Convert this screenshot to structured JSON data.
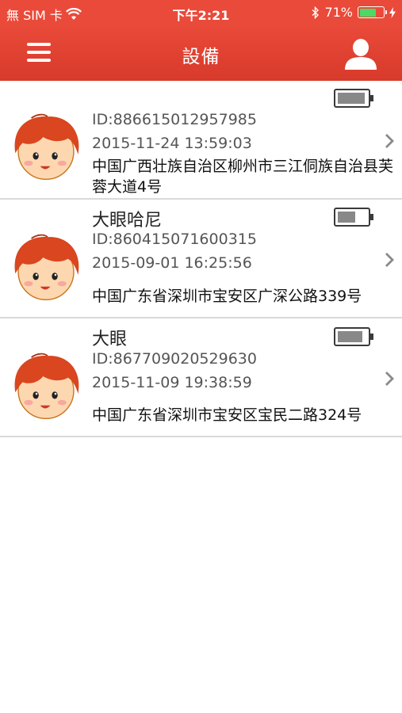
{
  "status_bar": {
    "carrier": "無 SIM 卡",
    "time": "下午2:21",
    "battery_percent": "71%",
    "battery_level": 0.71,
    "icons": [
      "wifi-icon",
      "bluetooth-icon",
      "battery-icon",
      "charging-bolt-icon"
    ]
  },
  "nav": {
    "title": "設備",
    "left_icon": "menu-icon",
    "right_icon": "user-icon"
  },
  "devices": [
    {
      "name": "",
      "id": "ID:886615012957985",
      "time": "2015-11-24 13:59:03",
      "address": "中国广西壮族自治区柳州市三江侗族自治县芙蓉大道4号",
      "battery_level": 0.95
    },
    {
      "name": "大眼哈尼",
      "id": "ID:860415071600315",
      "time": "2015-09-01 16:25:56",
      "address": "中国广东省深圳市宝安区广深公路339号",
      "battery_level": 0.6
    },
    {
      "name": "大眼",
      "id": "ID:867709020529630",
      "time": "2015-11-09 19:38:59",
      "address": "中国广东省深圳市宝安区宝民二路324号",
      "battery_level": 0.85
    }
  ],
  "colors": {
    "accent": "#e94a39",
    "status_battery": "#4cd964",
    "device_battery": "#888888"
  }
}
